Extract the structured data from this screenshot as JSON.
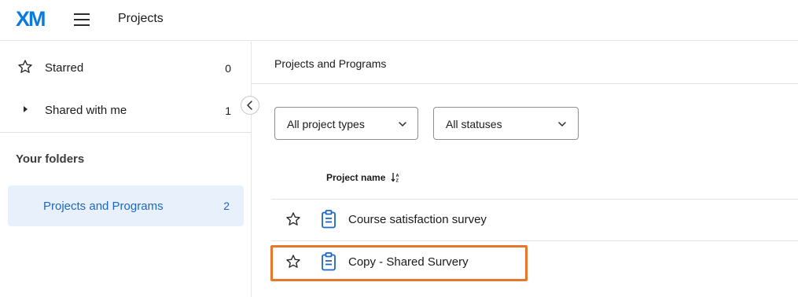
{
  "header": {
    "logo": "XM",
    "title": "Projects",
    "menu_icon": "hamburger-menu-icon"
  },
  "sidebar": {
    "items": [
      {
        "label": "Starred",
        "count": "0",
        "icon": "star-icon"
      },
      {
        "label": "Shared with me",
        "count": "1",
        "icon": "caret-right-icon"
      }
    ],
    "folders_title": "Your folders",
    "folders": [
      {
        "label": "Projects and Programs",
        "count": "2",
        "selected": true
      }
    ],
    "collapse_icon": "chevron-left-icon"
  },
  "main": {
    "breadcrumb": "Projects and Programs",
    "filters": [
      {
        "value": "All project types"
      },
      {
        "value": "All statuses"
      }
    ],
    "table": {
      "column_header": "Project name",
      "sort_icon": "sort-ascending-icon",
      "rows": [
        {
          "name": "Course satisfaction survey",
          "icon": "survey-clipboard-icon"
        },
        {
          "name": "Copy - Shared Survery",
          "icon": "survey-clipboard-icon",
          "highlighted": true
        }
      ]
    }
  },
  "colors": {
    "brand": "#0a7bde",
    "selected_bg": "#e8f1fb",
    "selected_text": "#1d66c4",
    "highlight": "#e8772e"
  }
}
